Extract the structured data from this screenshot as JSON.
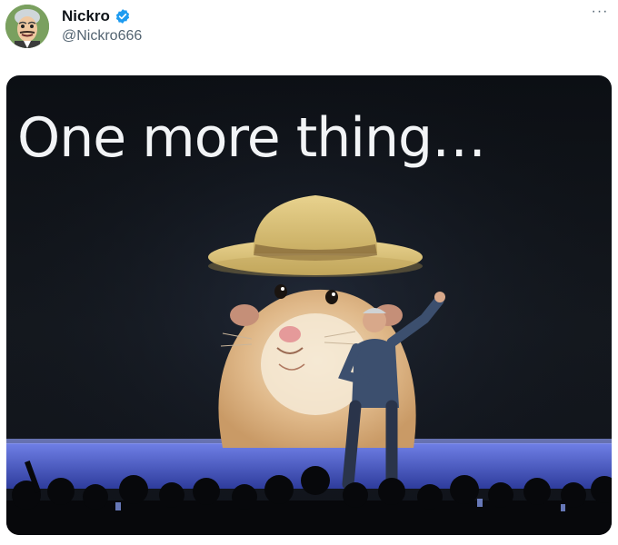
{
  "tweet": {
    "display_name": "Nickro",
    "handle": "@Nickro666",
    "more_label": "···"
  },
  "media": {
    "headline": "One more thing…"
  },
  "icons": {
    "verified": "verified-badge-icon",
    "more": "more-options-icon"
  },
  "colors": {
    "verified": "#1d9bf0",
    "stage_blue": "#4a5fd0",
    "handle_gray": "#536471"
  }
}
